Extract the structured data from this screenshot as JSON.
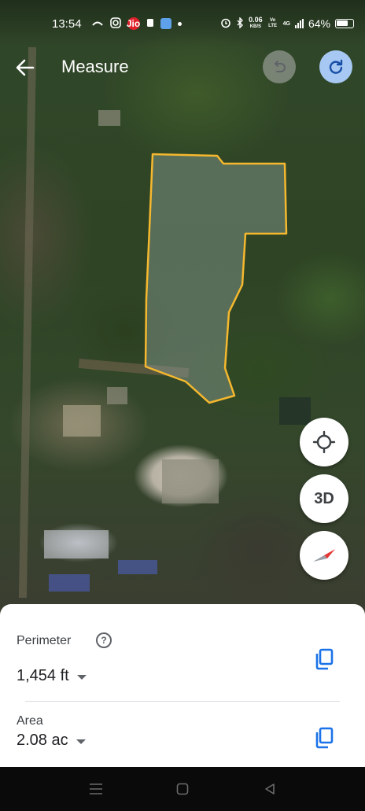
{
  "status_bar": {
    "time": "13:54",
    "carrier_badge": "Jio",
    "net_speed": "0.06",
    "net_speed_unit": "KB/S",
    "network_type": "4G",
    "volte": "Vo LTE",
    "battery": "64%",
    "icons": [
      "call-forward-icon",
      "instagram-icon",
      "jio-icon",
      "sim-icon",
      "app-icon",
      "dot-icon",
      "alarm-icon",
      "bluetooth-icon",
      "signal-icon",
      "battery-icon"
    ]
  },
  "app_bar": {
    "title": "Measure",
    "back_icon": "arrow-left-icon",
    "undo_icon": "undo-icon",
    "redo_icon": "redo-icon"
  },
  "map": {
    "polygon_color": "#f5b82e",
    "fab_buttons": [
      {
        "name": "my-location",
        "icon": "crosshair-icon"
      },
      {
        "name": "toggle-3d",
        "label": "3D"
      },
      {
        "name": "compass",
        "icon": "compass-icon"
      }
    ]
  },
  "measurement": {
    "perimeter_label": "Perimeter",
    "perimeter_value": "1,454 ft",
    "area_label": "Area",
    "area_value": "2.08 ac",
    "help_symbol": "?"
  },
  "colors": {
    "accent": "#1a73e8",
    "redo_bg": "#a6c8f2",
    "sheet_bg": "#ffffff"
  },
  "nav_bar": {
    "buttons": [
      "menu-icon",
      "home-icon",
      "back-triangle-icon"
    ]
  }
}
